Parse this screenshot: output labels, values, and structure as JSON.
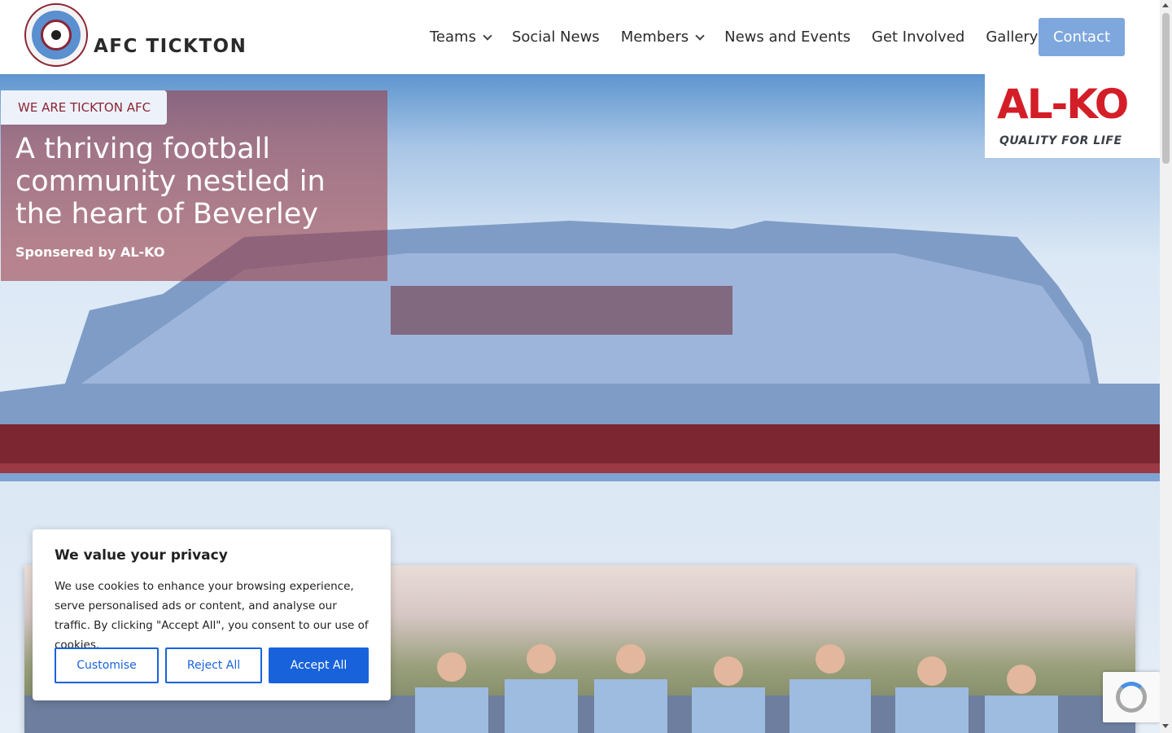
{
  "header": {
    "logo_text": "AFC TICKTON",
    "nav": [
      {
        "label": "Teams",
        "has_dropdown": true
      },
      {
        "label": "Social News",
        "has_dropdown": false
      },
      {
        "label": "Members",
        "has_dropdown": true
      },
      {
        "label": "News and Events",
        "has_dropdown": false
      },
      {
        "label": "Get Involved",
        "has_dropdown": false
      },
      {
        "label": "Gallery",
        "has_dropdown": false
      }
    ],
    "contact_label": "Contact"
  },
  "hero": {
    "tag": "WE ARE TICKTON AFC",
    "title": "A thriving football community nestled in the heart of Beverley",
    "sponsor_line": "Sponsered by AL-KO"
  },
  "sponsor": {
    "brand": "AL-KO",
    "tagline": "QUALITY FOR LIFE"
  },
  "cookie": {
    "title": "We value your privacy",
    "text": "We use cookies to enhance your browsing experience, serve personalised ads or content, and analyse our traffic. By clicking \"Accept All\", you consent to our use of cookies.",
    "customise_label": "Customise",
    "reject_label": "Reject All",
    "accept_label": "Accept All"
  },
  "colors": {
    "club_maroon": "#9b3a44",
    "club_sky": "#7ea7dd",
    "cookie_blue": "#1863dc",
    "alko_red": "#d31e28"
  }
}
